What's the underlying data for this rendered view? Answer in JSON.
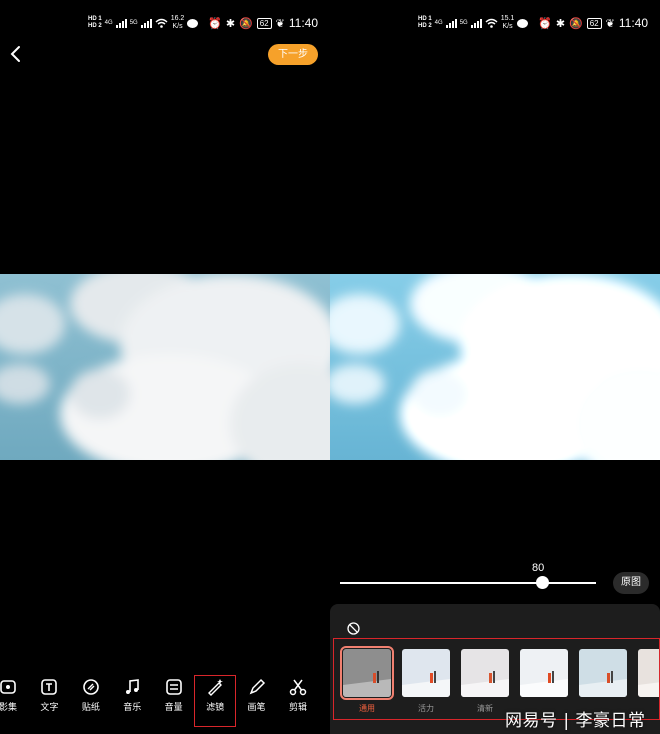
{
  "left_screen": {
    "status": {
      "hd_1": "HD 1",
      "hd_2": "HD 2",
      "net_4g": "4G",
      "net_5g": "5G",
      "speed_value": "16.2",
      "speed_unit": "K/s",
      "battery": "62",
      "time": "11:40"
    },
    "next_button": "下一步",
    "toolbar": [
      {
        "label": "影集",
        "icon": "album-icon"
      },
      {
        "label": "文字",
        "icon": "text-icon"
      },
      {
        "label": "贴纸",
        "icon": "sticker-icon"
      },
      {
        "label": "音乐",
        "icon": "music-icon"
      },
      {
        "label": "音量",
        "icon": "volume-icon"
      },
      {
        "label": "滤镜",
        "icon": "filter-icon",
        "selected": true
      },
      {
        "label": "画笔",
        "icon": "brush-icon"
      },
      {
        "label": "剪辑",
        "icon": "scissors-icon"
      }
    ]
  },
  "right_screen": {
    "status": {
      "hd_1": "HD 1",
      "hd_2": "HD 2",
      "net_4g": "4G",
      "net_5g": "5G",
      "speed_value": "15.1",
      "speed_unit": "K/s",
      "battery": "62",
      "time": "11:40"
    },
    "intensity": {
      "value": "80",
      "fraction": 0.8
    },
    "original_button": "原图",
    "filters": [
      {
        "label": "通用",
        "active": true
      },
      {
        "label": "活力"
      },
      {
        "label": "清新"
      },
      {
        "label": ""
      },
      {
        "label": ""
      },
      {
        "label": ""
      }
    ]
  },
  "watermark": "网易号 | 李豪日常",
  "colors": {
    "accent_orange": "#f6a12a",
    "highlight_red": "#d9262b",
    "active_filter": "#f0603e",
    "sky_blue": "#7fb3c9"
  }
}
